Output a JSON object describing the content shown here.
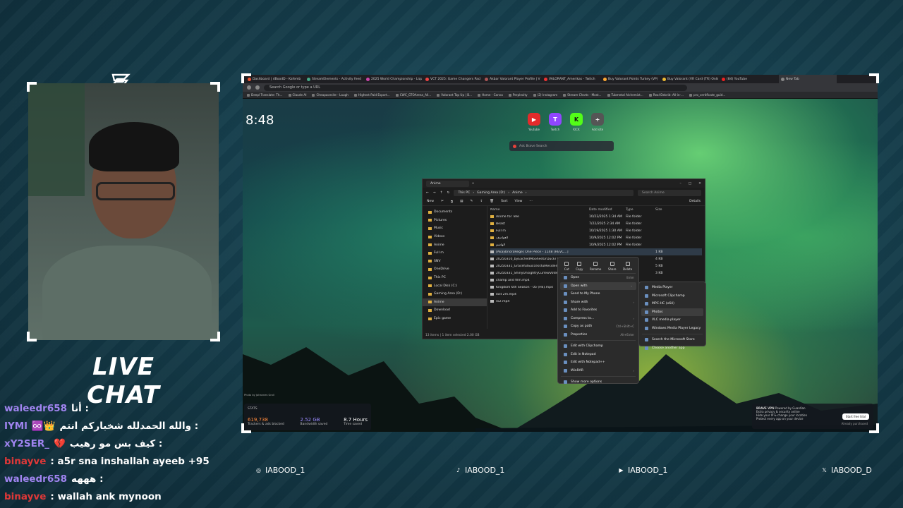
{
  "colors": {
    "accent_green": "#9ad35a",
    "bg": "#163f4d"
  },
  "live_chat_title": "LIVE CHAT",
  "chat": [
    {
      "user": "waleedr658",
      "user_color": "#a084f0",
      "message": "أنا :"
    },
    {
      "user": "IYMl",
      "user_color": "#a084f0",
      "badges": "♾️👑",
      "message": "والله الحمدلله شخباركم انتم :"
    },
    {
      "user": "xY2SER_",
      "user_color": "#a084f0",
      "badges": "💔",
      "message": "كيف بس مو رهيب :"
    },
    {
      "user": "binayve",
      "user_color": "#e03838",
      "message": ": a5r sna inshallah ayeeb +95"
    },
    {
      "user": "waleedr658",
      "user_color": "#a084f0",
      "message": "هههه :"
    },
    {
      "user": "binayve",
      "user_color": "#e03838",
      "message": ": wallah ank mynoon"
    }
  ],
  "socials": [
    {
      "icon": "instagram-icon",
      "handle": "IABOOD_1"
    },
    {
      "icon": "tiktok-icon",
      "handle": "IABOOD_1"
    },
    {
      "icon": "youtube-icon",
      "handle": "IABOOD_1"
    },
    {
      "icon": "x-icon",
      "handle": "IABOOD_D"
    }
  ],
  "browser": {
    "tabs": [
      "Dashboard | dBoodD - Kafemb",
      "StreamElements - Activity feed",
      "2025 World Championship - Liqui",
      "VCT 2025: Game Changers Pacific",
      "Akbar Valorant Player Profile | VLR",
      "VALORANT_Amerikas - Twitch",
      "Buy Valorant Points Turkey (VP)",
      "Buy Valorant (VR Card (TR) Online",
      "(84) YouTube",
      "New Tab"
    ],
    "address_placeholder": "Search Google or type a URL",
    "bookmarks": [
      "Deepl Translate: Th...",
      "Claude AI",
      "Cheapacesite - Laugh",
      "Highest Paid Esport...",
      "CWC_GTOArena_All...",
      "Valorant Top Up | B...",
      "Home - Canva",
      "Perplexity",
      "(2) Instagram",
      "Stream Charts - Most...",
      "Tubmetal Alchemist...",
      "Real-Debrid: All-in-...",
      "pro_certificate_guid..."
    ],
    "clock": "8:48",
    "shortcuts": [
      {
        "label": "Youtube",
        "glyph": "▶",
        "color": "#e32b2b"
      },
      {
        "label": "Twitch",
        "glyph": "T",
        "color": "#9146ff"
      },
      {
        "label": "KICK",
        "glyph": "K",
        "color": "#53fc18"
      },
      {
        "label": "Add site",
        "glyph": "+",
        "color": "#555555"
      }
    ],
    "search_placeholder": "Ask Brave Search",
    "photo_credit": "Photo by Johannes Groll",
    "stats": {
      "title": "STATS",
      "items": [
        {
          "value": "619,738",
          "label": "Trackers & ads blocked"
        },
        {
          "value": "2.52 GB",
          "label": "Bandwidth saved"
        },
        {
          "value": "8.7 Hours",
          "label": "Time saved"
        }
      ]
    },
    "vpn": {
      "title": "BRAVE VPN",
      "powered": "Powered by Guardian",
      "lines": [
        "Extra privacy & security online",
        "Hide your IP & change your location",
        "Protect every app on your device"
      ],
      "button": "Start free trial",
      "footer": "Already purchased"
    }
  },
  "explorer": {
    "tab": "Anime",
    "breadcrumb": [
      "This PC",
      "Gaming Area (D:)",
      "Anime"
    ],
    "search_placeholder": "Search Anime",
    "toolbar": {
      "new": "New",
      "sort": "Sort",
      "view": "View",
      "details": "Details"
    },
    "sidebar": [
      "Documents",
      "Pictures",
      "Music",
      "Videos",
      "Anime",
      "Full m",
      "SNV",
      "OneDrive",
      "This PC",
      "Local Disk (C:)",
      "Gaming Area (D:)",
      "Anime",
      "Download",
      "Epic game"
    ],
    "columns": {
      "name": "Name",
      "date": "Date modified",
      "type": "Type",
      "size": "Size"
    },
    "rows": [
      {
        "name": "Anime for Tele",
        "date": "10/22/2025 1:34 AM",
        "type": "File folder",
        "size": "",
        "file": false
      },
      {
        "name": "Beast",
        "date": "7/22/2025 2:34 AM",
        "type": "File folder",
        "size": "",
        "file": false
      },
      {
        "name": "Full m",
        "date": "10/19/2025 1:30 AM",
        "type": "File folder",
        "size": "",
        "file": false
      },
      {
        "name": "العواصف",
        "date": "10/9/2025 12:02 PM",
        "type": "File folder",
        "size": "",
        "file": false
      },
      {
        "name": "الهاشم",
        "date": "10/9/2025 12:02 PM",
        "type": "File folder",
        "size": "",
        "file": false
      },
      {
        "name": "[AkaybnoraRege] One Piece - 1148 [HEVC...]",
        "date": "",
        "type": "",
        "size": "1 KB",
        "file": true,
        "selected": true
      },
      {
        "name": "20250310_byEachedMoohedOrDuckr B...",
        "date": "",
        "type": "",
        "size": "4 KB",
        "file": true
      },
      {
        "name": "20250331_GracefulSuccessfulResidentSk...",
        "date": "",
        "type": "",
        "size": "5 KB",
        "file": true
      },
      {
        "name": "20250331_ShinyUnsightlyCurlewVoteNay...",
        "date": "",
        "type": "",
        "size": "3 KB",
        "file": true
      },
      {
        "name": "champ and film.mp4",
        "date": "",
        "type": "",
        "size": "",
        "file": true
      },
      {
        "name": "Kingdom 6th Season - 05 (Hk).mp4",
        "date": "",
        "type": "",
        "size": "",
        "file": true
      },
      {
        "name": "last 2m.mp4",
        "date": "",
        "type": "",
        "size": "",
        "file": true
      },
      {
        "name": "ro2.mp4",
        "date": "",
        "type": "",
        "size": "",
        "file": true
      }
    ],
    "status": "13 items  |  1 item selected  2.00 GB"
  },
  "context_menu": {
    "quick": [
      "Cut",
      "Copy",
      "Rename",
      "Share",
      "Delete"
    ],
    "items": [
      {
        "label": "Open",
        "shortcut": "Enter"
      },
      {
        "label": "Open with",
        "shortcut": "›",
        "highlight": true
      },
      {
        "label": "Send to My Phone",
        "shortcut": ""
      },
      {
        "label": "Share with",
        "shortcut": "›"
      },
      {
        "label": "Add to Favorites",
        "shortcut": ""
      },
      {
        "label": "Compress to...",
        "shortcut": "›"
      },
      {
        "label": "Copy as path",
        "shortcut": "Ctrl+Shift+C"
      },
      {
        "label": "Properties",
        "shortcut": "Alt+Enter"
      },
      {
        "label": "Edit with Clipchamp",
        "shortcut": ""
      },
      {
        "label": "Edit in Notepad",
        "shortcut": ""
      },
      {
        "label": "Edit with Notepad++",
        "shortcut": ""
      },
      {
        "label": "WinRAR",
        "shortcut": "›"
      },
      {
        "label": "Show more options",
        "shortcut": ""
      }
    ],
    "submenu": [
      "Media Player",
      "Microsoft Clipchamp",
      "MPC-HC (x64)",
      "Photos",
      "VLC media player",
      "Windows Media Player Legacy",
      "Search the Microsoft Store",
      "Choose another app"
    ]
  }
}
